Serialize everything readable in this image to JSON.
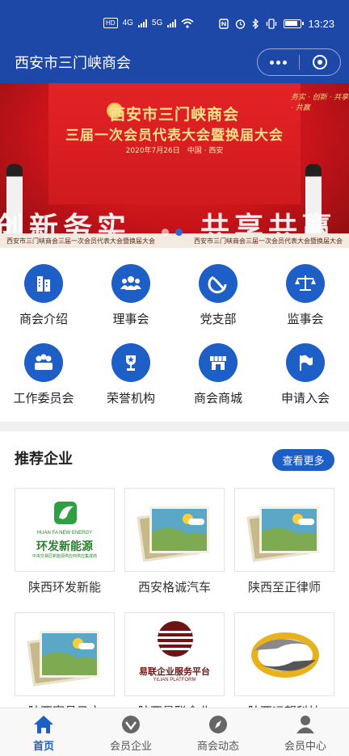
{
  "status_bar": {
    "time": "13:23",
    "hd": "HD",
    "net1": "4G",
    "net2": "5G"
  },
  "nav": {
    "title": "西安市三门峡商会"
  },
  "banner": {
    "title_line1": "西安市三门峡商会",
    "title_line2": "三届一次会员代表大会暨换届大会",
    "date_place": "2020年7月26日　中国 · 西安",
    "slogan": "务实 · 创新 · 共享 · 共赢",
    "big_left": "创新务实",
    "big_right": "共享共赢",
    "strip_left": "西安市三门峡商会三届一次会员代表大会暨换届大会",
    "strip_right": "西安市三门峡商会三届一次会员代表大会暨换届大会",
    "page_index": 2,
    "page_count": 3
  },
  "menu": [
    {
      "label": "商会介绍",
      "icon": "building-icon"
    },
    {
      "label": "理事会",
      "icon": "group-icon"
    },
    {
      "label": "党支部",
      "icon": "hammer-sickle-icon"
    },
    {
      "label": "监事会",
      "icon": "scales-icon"
    },
    {
      "label": "工作委员会",
      "icon": "committee-icon"
    },
    {
      "label": "荣誉机构",
      "icon": "trophy-icon"
    },
    {
      "label": "商会商城",
      "icon": "shop-icon"
    },
    {
      "label": "申请入会",
      "icon": "flag-icon"
    }
  ],
  "recommend": {
    "title": "推荐企业",
    "more": "查看更多",
    "items": [
      {
        "name": "陕西环发新能",
        "logo_text": "环发新能源",
        "logo_sub": "HUAN FA NEW ENERGY",
        "logo_tag": "中央交易区新能源供应商供应集成商"
      },
      {
        "name": "西安格诚汽车",
        "logo_text": ""
      },
      {
        "name": "陕西至正律师",
        "logo_text": ""
      },
      {
        "name": "陕西富县马文",
        "logo_text": ""
      },
      {
        "name": "陕西易联企业",
        "logo_text": "易联企业服务平台",
        "logo_sub": "YILIAN PLATFORM"
      },
      {
        "name": "陕西远望科技",
        "logo_text": ""
      }
    ]
  },
  "tabs": [
    {
      "label": "首页",
      "icon": "home-icon",
      "active": true
    },
    {
      "label": "会员企业",
      "icon": "member-company-icon",
      "active": false
    },
    {
      "label": "商会动态",
      "icon": "compass-icon",
      "active": false
    },
    {
      "label": "会员中心",
      "icon": "user-icon",
      "active": false
    }
  ],
  "colors": {
    "brand": "#1e48a8",
    "accent": "#1d5ec7"
  }
}
